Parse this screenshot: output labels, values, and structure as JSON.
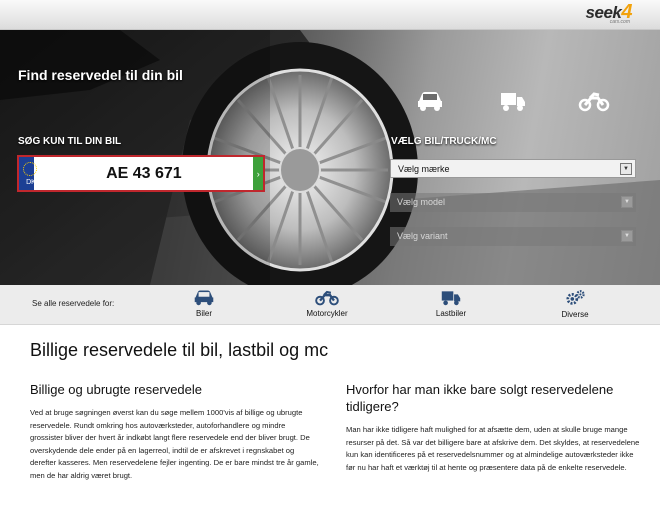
{
  "header": {
    "logo_main": "seek",
    "logo_four": "4",
    "logo_sub": "cars.com"
  },
  "hero": {
    "title": "Find reservedel til din bil",
    "plate_section_label": "SØG KUN TIL DIN BIL",
    "plate": {
      "country_code": "DK",
      "value": "AE 43 671",
      "go_symbol": "›"
    },
    "vehicle_types": [
      {
        "icon": "car-icon"
      },
      {
        "icon": "truck-icon"
      },
      {
        "icon": "motorcycle-icon"
      }
    ],
    "vehicle_section_label": "VÆLG BIL/TRUCK/MC",
    "selects": {
      "make": "Vælg mærke",
      "model": "Vælg model",
      "variant": "Vælg variant"
    }
  },
  "category_bar": {
    "lead": "Se alle reservedele for:",
    "items": [
      {
        "label": "Biler",
        "icon": "car-icon"
      },
      {
        "label": "Motorcykler",
        "icon": "motorcycle-icon"
      },
      {
        "label": "Lastbiler",
        "icon": "truck-icon"
      },
      {
        "label": "Diverse",
        "icon": "gears-icon"
      }
    ]
  },
  "content": {
    "title": "Billige reservedele til bil, lastbil og mc",
    "left": {
      "heading": "Billige og ubrugte reservedele",
      "body": "Ved at bruge søgningen øverst kan du søge mellem 1000'vis af billige og ubrugte reservedele. Rundt omkring hos autoværksteder, autoforhandlere og mindre grossister bliver der hvert år indkøbt langt flere reservedele end der bliver brugt. De overskydende dele ender på en lagerreol, indtil de er afskrevet i regnskabet og derefter kasseres. Men reservedelene fejler ingenting. De er bare mindst tre år gamle, men de har aldrig været brugt."
    },
    "right": {
      "heading": "Hvorfor har man ikke bare solgt reservedelene tidligere?",
      "body": "Man har ikke tidligere haft mulighed for at afsætte dem, uden at skulle bruge mange resurser på det. Så var det billigere bare at afskrive dem. Det skyldes, at reservedelene kun kan identificeres på et reservedelsnummer og at almindelige autoværksteder ikke før nu har haft et værktøj til at hente og præsentere data på de enkelte reservedele."
    }
  },
  "colors": {
    "plate_border": "#c0272d",
    "eu_band": "#1c3f94",
    "go_button": "#3ea13b",
    "logo_accent": "#f2a20c"
  }
}
